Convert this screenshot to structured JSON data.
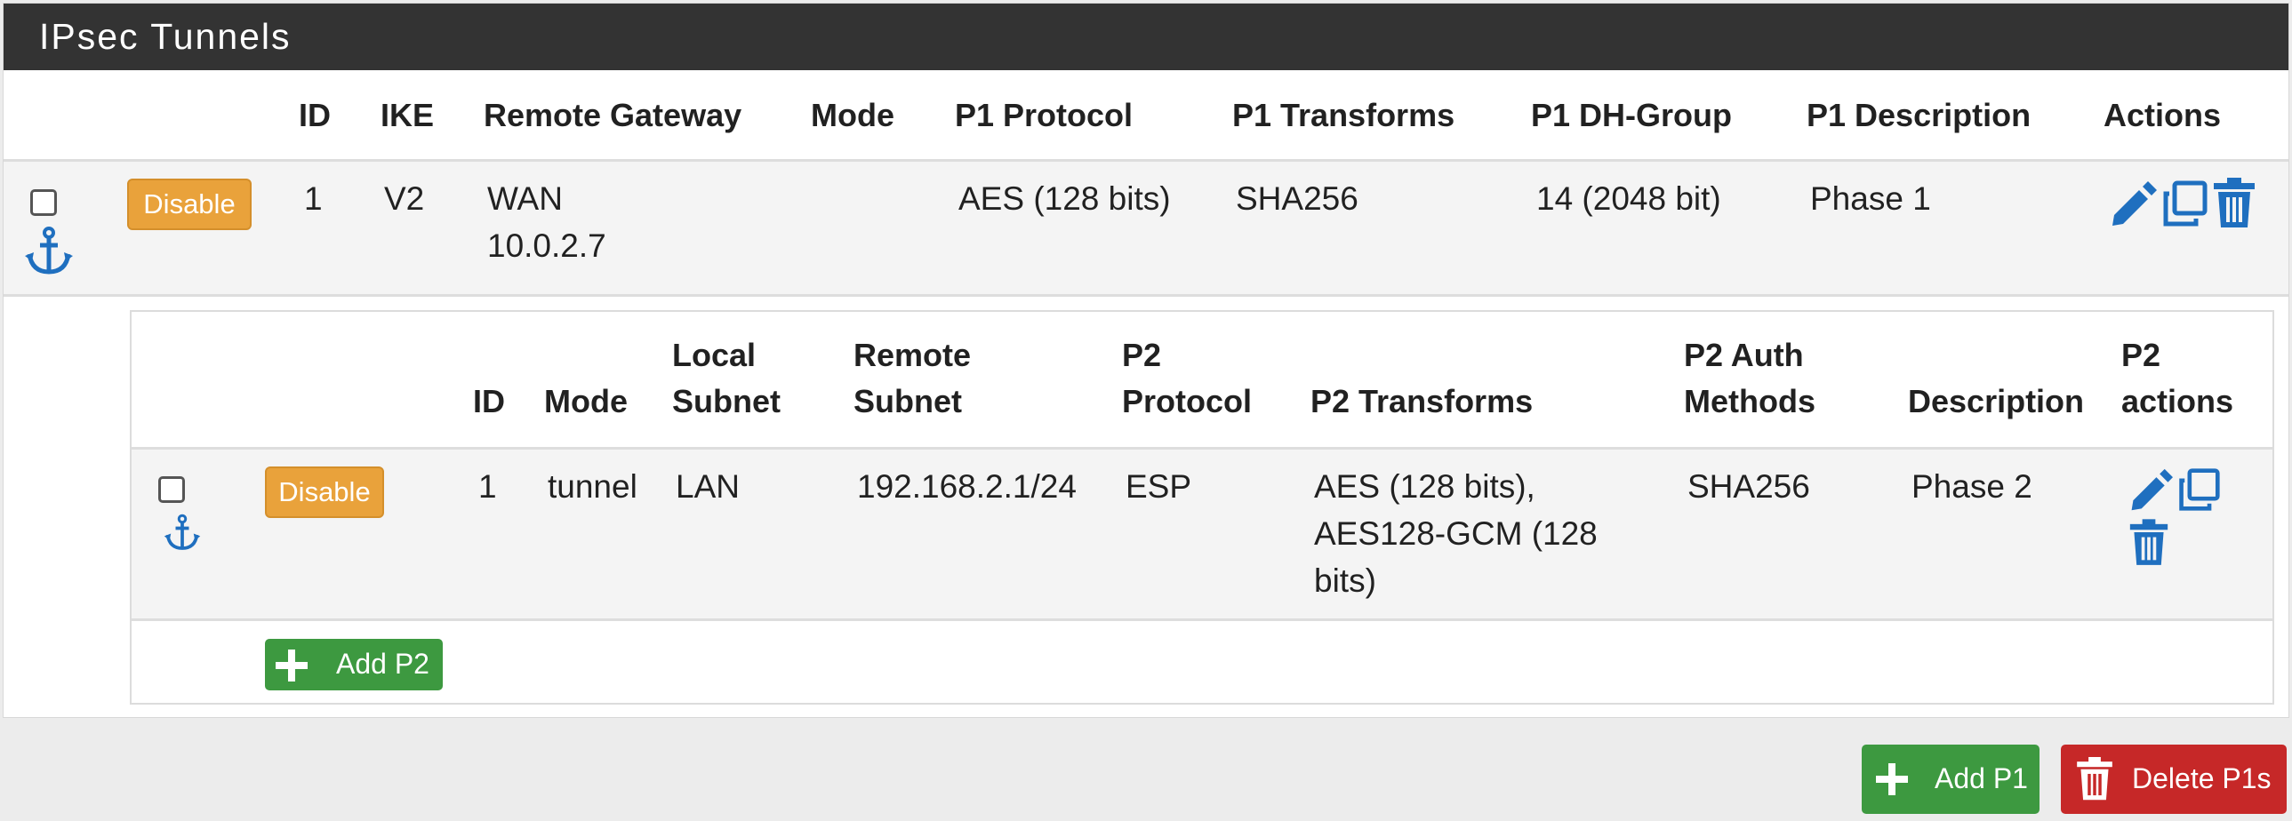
{
  "panel": {
    "title": "IPsec Tunnels"
  },
  "p1_headers": {
    "id": "ID",
    "ike": "IKE",
    "remote_gateway": "Remote Gateway",
    "mode": "Mode",
    "protocol": "P1 Protocol",
    "transforms": "P1 Transforms",
    "dh_group": "P1 DH-Group",
    "description": "P1 Description",
    "actions": "Actions"
  },
  "p1_row": {
    "disable_label": "Disable",
    "id": "1",
    "ike": "V2",
    "remote_gateway_line1": "WAN",
    "remote_gateway_line2": "10.0.2.7",
    "mode": "",
    "protocol": "AES (128 bits)",
    "transforms": "SHA256",
    "dh_group": "14 (2048 bit)",
    "description": "Phase 1"
  },
  "p2_headers": {
    "id": "ID",
    "mode": "Mode",
    "local_subnet_1": "Local",
    "local_subnet_2": "Subnet",
    "remote_subnet_1": "Remote",
    "remote_subnet_2": "Subnet",
    "protocol_1": "P2",
    "protocol_2": "Protocol",
    "transforms": "P2 Transforms",
    "auth_1": "P2 Auth",
    "auth_2": "Methods",
    "description": "Description",
    "actions_1": "P2",
    "actions_2": "actions"
  },
  "p2_row": {
    "disable_label": "Disable",
    "id": "1",
    "mode": "tunnel",
    "local_subnet": "LAN",
    "remote_subnet": "192.168.2.1/24",
    "protocol": "ESP",
    "transforms_1": "AES (128 bits),",
    "transforms_2": "AES128-GCM (128",
    "transforms_3": "bits)",
    "auth": "SHA256",
    "description": "Phase 2"
  },
  "buttons": {
    "add_p2": "Add P2",
    "add_p1": "Add P1",
    "delete_p1s": "Delete P1s"
  },
  "icons": [
    "anchor-icon",
    "pencil-icon",
    "copy-icon",
    "trash-icon",
    "plus-icon"
  ],
  "colors": {
    "header_bg": "#333333",
    "disable": "#e9a23b",
    "green": "#3d9940",
    "red": "#c62828",
    "icon_blue": "#1f6fbf"
  }
}
